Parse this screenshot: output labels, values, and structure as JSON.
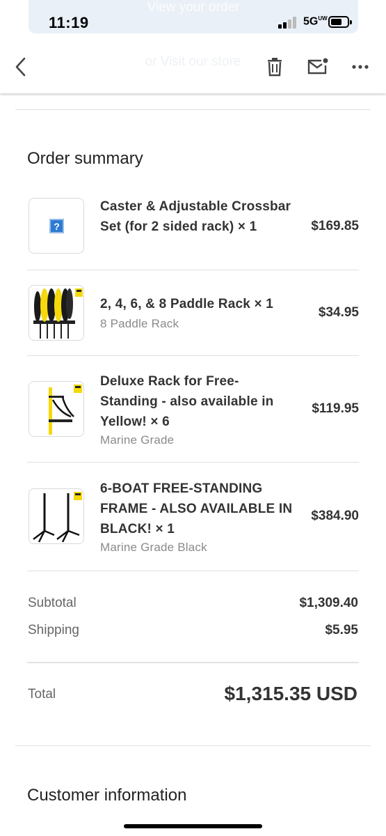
{
  "status_bar": {
    "time": "11:19",
    "network": "5G",
    "network_badge": "UW"
  },
  "banner_ghost_text": "View your order",
  "toolbar": {
    "ghost_text": "or Visit our store",
    "back_icon": "chevron-left-icon",
    "trash_icon": "trash-icon",
    "mail_icon": "mail-unread-icon",
    "more_icon": "more-horizontal-icon"
  },
  "order_summary": {
    "heading": "Order summary",
    "items": [
      {
        "title": "Caster & Adjustable Crossbar Set (for 2 sided rack) × 1",
        "variant": "",
        "price": "$169.85",
        "image": "broken-image-icon"
      },
      {
        "title": "2, 4, 6, & 8 Paddle Rack × 1",
        "variant": "8 Paddle Rack",
        "price": "$34.95",
        "image": "paddle-rack-photo"
      },
      {
        "title": "Deluxe Rack for Free-Standing - also available in Yellow! × 6",
        "variant": "Marine Grade",
        "price": "$119.95",
        "image": "deluxe-rack-photo"
      },
      {
        "title": "6-BOAT FREE-STANDING FRAME - ALSO AVAILABLE IN BLACK! × 1",
        "variant": "Marine Grade Black",
        "price": "$384.90",
        "image": "free-standing-frame-photo"
      }
    ],
    "subtotal_label": "Subtotal",
    "subtotal_value": "$1,309.40",
    "shipping_label": "Shipping",
    "shipping_value": "$5.95",
    "total_label": "Total",
    "total_value": "$1,315.35 USD"
  },
  "customer_information": {
    "heading": "Customer information"
  },
  "colors": {
    "text": "#333333",
    "muted": "#8a8a8a",
    "divider": "#e0e0e0",
    "rack_yellow": "#f5d90a"
  }
}
